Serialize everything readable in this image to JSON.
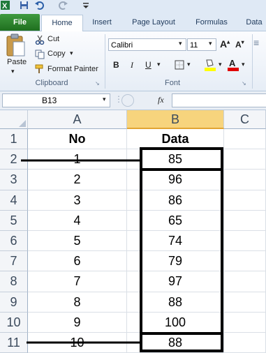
{
  "qat": {
    "icons": [
      "excel-icon",
      "save-icon",
      "undo-icon",
      "redo-icon",
      "customize-icon"
    ]
  },
  "tabs": [
    {
      "label": "File"
    },
    {
      "label": "Home"
    },
    {
      "label": "Insert"
    },
    {
      "label": "Page Layout"
    },
    {
      "label": "Formulas"
    },
    {
      "label": "Data"
    }
  ],
  "clipboard": {
    "paste": "Paste",
    "cut": "Cut",
    "copy": "Copy",
    "format_painter": "Format Painter",
    "label": "Clipboard"
  },
  "font": {
    "name": "Calibri",
    "size": "11",
    "label": "Font",
    "bold": "B",
    "italic": "I",
    "underline": "U",
    "fill_color": "#ffff00",
    "font_color": "#e00000"
  },
  "formula_bar": {
    "name_box": "B13",
    "fx": "fx",
    "value": ""
  },
  "columns": [
    "A",
    "B",
    "C"
  ],
  "rows": [
    {
      "num": "1",
      "a": "No",
      "b": "Data"
    },
    {
      "num": "2",
      "a": "1",
      "b": "85"
    },
    {
      "num": "3",
      "a": "2",
      "b": "96"
    },
    {
      "num": "4",
      "a": "3",
      "b": "86"
    },
    {
      "num": "5",
      "a": "4",
      "b": "65"
    },
    {
      "num": "6",
      "a": "5",
      "b": "74"
    },
    {
      "num": "7",
      "a": "6",
      "b": "79"
    },
    {
      "num": "8",
      "a": "7",
      "b": "97"
    },
    {
      "num": "9",
      "a": "8",
      "b": "88"
    },
    {
      "num": "10",
      "a": "9",
      "b": "100"
    },
    {
      "num": "11",
      "a": "10",
      "b": "88"
    }
  ],
  "colors": {
    "header_selected": "#f7d47d",
    "accent_green": "#217346"
  }
}
